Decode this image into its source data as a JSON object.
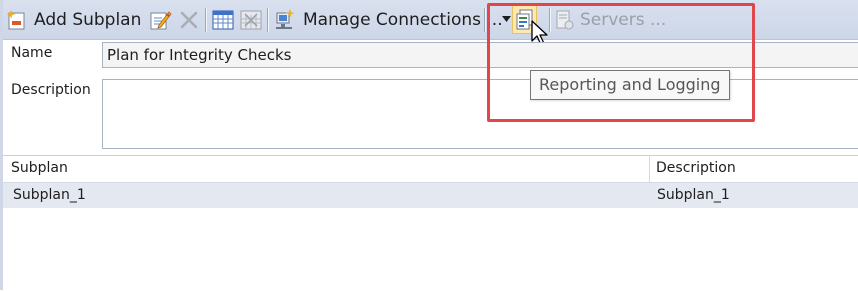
{
  "toolbar": {
    "add_subplan_label": "Add Subplan",
    "manage_connections_label": "Manage Connections ...",
    "servers_label": "Servers ..."
  },
  "form": {
    "name_label": "Name",
    "name_value": "Plan for Integrity Checks",
    "description_label": "Description",
    "description_value": ""
  },
  "grid": {
    "columns": [
      "Subplan",
      "Description"
    ],
    "rows": [
      {
        "subplan": "Subplan_1",
        "description": "Subplan_1"
      }
    ]
  },
  "tooltip": {
    "text": "Reporting and Logging"
  },
  "colors": {
    "toolbar_bg": "#d3dbeb",
    "selected_row": "#e4e9f1",
    "highlight_box": "#e0474c"
  }
}
